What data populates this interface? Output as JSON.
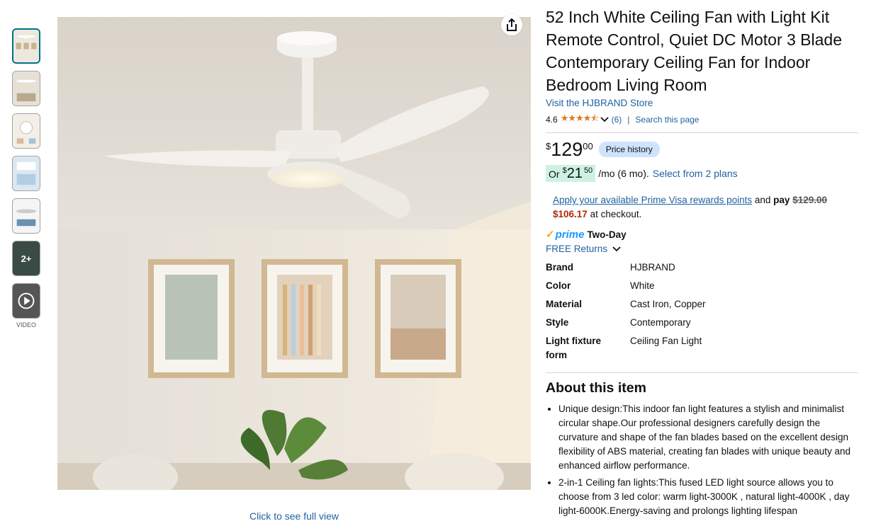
{
  "gallery": {
    "more_label": "2+",
    "video_label": "VIDEO",
    "full_view": "Click to see full view",
    "share_icon": "share-icon"
  },
  "product": {
    "title": "52 Inch White Ceiling Fan with Light Kit Remote Control, Quiet DC Motor 3 Blade Contemporary Ceiling Fan for Indoor Bedroom Living Room",
    "store": "Visit the HJBRAND Store",
    "rating": "4.6",
    "stars": "★★★★⯪",
    "rating_count": "(6)",
    "search_page": "Search this page"
  },
  "price": {
    "currency": "$",
    "whole": "129",
    "fraction": "00",
    "history_btn": "Price history",
    "emi_or": "Or",
    "emi_currency": "$",
    "emi_whole": "21",
    "emi_fraction": "50",
    "emi_term": "/mo (6 mo).",
    "emi_link": "Select from 2 plans",
    "visa_link": "Apply your available Prime Visa rewards points",
    "visa_and": " and ",
    "visa_pay": "pay",
    "visa_old": "$129.00",
    "visa_new": "$106.17",
    "visa_checkout": " at checkout."
  },
  "delivery": {
    "prime": "prime",
    "two_day": "Two-Day",
    "returns": "FREE Returns"
  },
  "specs": [
    {
      "k": "Brand",
      "v": "HJBRAND"
    },
    {
      "k": "Color",
      "v": "White"
    },
    {
      "k": "Material",
      "v": "Cast Iron, Copper"
    },
    {
      "k": "Style",
      "v": "Contemporary"
    },
    {
      "k": "Light fixture form",
      "v": "Ceiling Fan Light"
    }
  ],
  "about": {
    "heading": "About this item",
    "bullets": [
      "Unique design:This indoor fan light features a stylish and minimalist circular shape.Our professional designers carefully design the curvature and shape of the fan blades based on the excellent design flexibility of ABS material, creating fan blades with unique beauty and enhanced airflow performance.",
      "2-in-1 Ceiling fan lights:This fused LED light source allows you to choose from 3 led color: warm light-3000K , natural light-4000K , day light-6000K.Energy-saving and prolongs lighting lifespan"
    ]
  }
}
